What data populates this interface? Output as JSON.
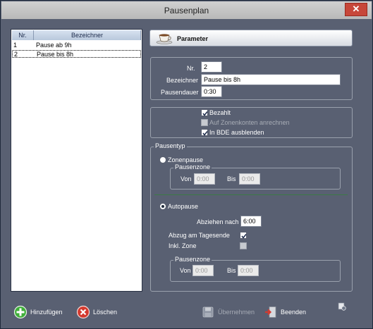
{
  "window": {
    "title": "Pausenplan",
    "close_glyph": "✕"
  },
  "list": {
    "columns": {
      "nr": "Nr.",
      "bezeichner": "Bezeichner"
    },
    "rows": [
      {
        "nr": "1",
        "bezeichner": "Pause ab 9h"
      },
      {
        "nr": "2",
        "bezeichner": "Pause bis 8h"
      }
    ],
    "selected_row": 2
  },
  "parameter_tab": {
    "label": "Parameter",
    "icon": "coffee-cup-icon"
  },
  "params": {
    "nr_label": "Nr.",
    "nr_value": "2",
    "bezeichner_label": "Bezeichner",
    "bezeichner_value": "Pause bis 8h",
    "dauer_label": "Pausendauer",
    "dauer_value": "0:30"
  },
  "options": {
    "bezahlt": {
      "label": "Bezahlt",
      "checked": true
    },
    "zonenkonten": {
      "label": "Auf Zonenkonten anrechnen",
      "checked": false,
      "disabled": true
    },
    "bde": {
      "label": "In BDE ausblenden",
      "checked": true
    }
  },
  "pausentyp": {
    "legend": "Pausentyp",
    "zonenpause": {
      "label": "Zonenpause",
      "selected": false,
      "zone_legend": "Pausenzone",
      "von_label": "Von",
      "von_value": "0:00",
      "bis_label": "Bis",
      "bis_value": "0:00"
    },
    "autopause": {
      "label": "Autopause",
      "selected": true,
      "abziehen_label": "Abziehen nach",
      "abziehen_value": "6:00",
      "abzug_label": "Abzug am Tagesende",
      "abzug_checked": true,
      "inkl_label": "Inkl. Zone",
      "inkl_checked": false,
      "zone_legend": "Pausenzone",
      "von_label": "Von",
      "von_value": "0:00",
      "bis_label": "Bis",
      "bis_value": "0:00"
    }
  },
  "buttons": {
    "add": "Hinzufügen",
    "delete": "Löschen",
    "apply": "Übernehmen",
    "exit": "Beenden"
  },
  "colors": {
    "background": "#596072",
    "accent_green": "#3c7a45",
    "close_red": "#c7473a"
  }
}
